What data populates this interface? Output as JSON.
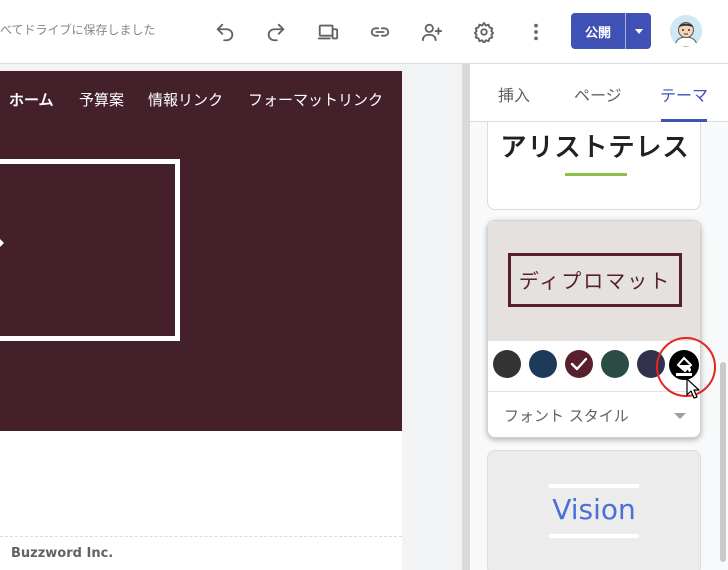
{
  "toolbar": {
    "save_status": "べてドライブに保存しました",
    "icons": [
      "undo-icon",
      "redo-icon",
      "preview-devices-icon",
      "link-icon",
      "share-icon",
      "settings-icon",
      "more-vert-icon"
    ],
    "publish_label": "公開",
    "accent": "#3f51b5"
  },
  "site": {
    "nav": [
      "ホーム",
      "予算案",
      "情報リンク",
      "フォーマットリンク"
    ],
    "hero_glyph": "🏠",
    "hero_color": "#43202a",
    "footer": "Buzzword Inc."
  },
  "panel": {
    "tabs": [
      "挿入",
      "ページ",
      "テーマ"
    ],
    "active_tab": "テーマ",
    "themes": {
      "aristotle": {
        "title": "アリストテレス"
      },
      "diplomat": {
        "title": "ディプロマット",
        "swatches": [
          "#333333",
          "#1e3a5a",
          "#58202e",
          "#2a4c44",
          "#31314e"
        ],
        "selected_swatch": "#58202e",
        "font_style_label": "フォント スタイル"
      },
      "vision": {
        "title": "Vision"
      }
    }
  }
}
